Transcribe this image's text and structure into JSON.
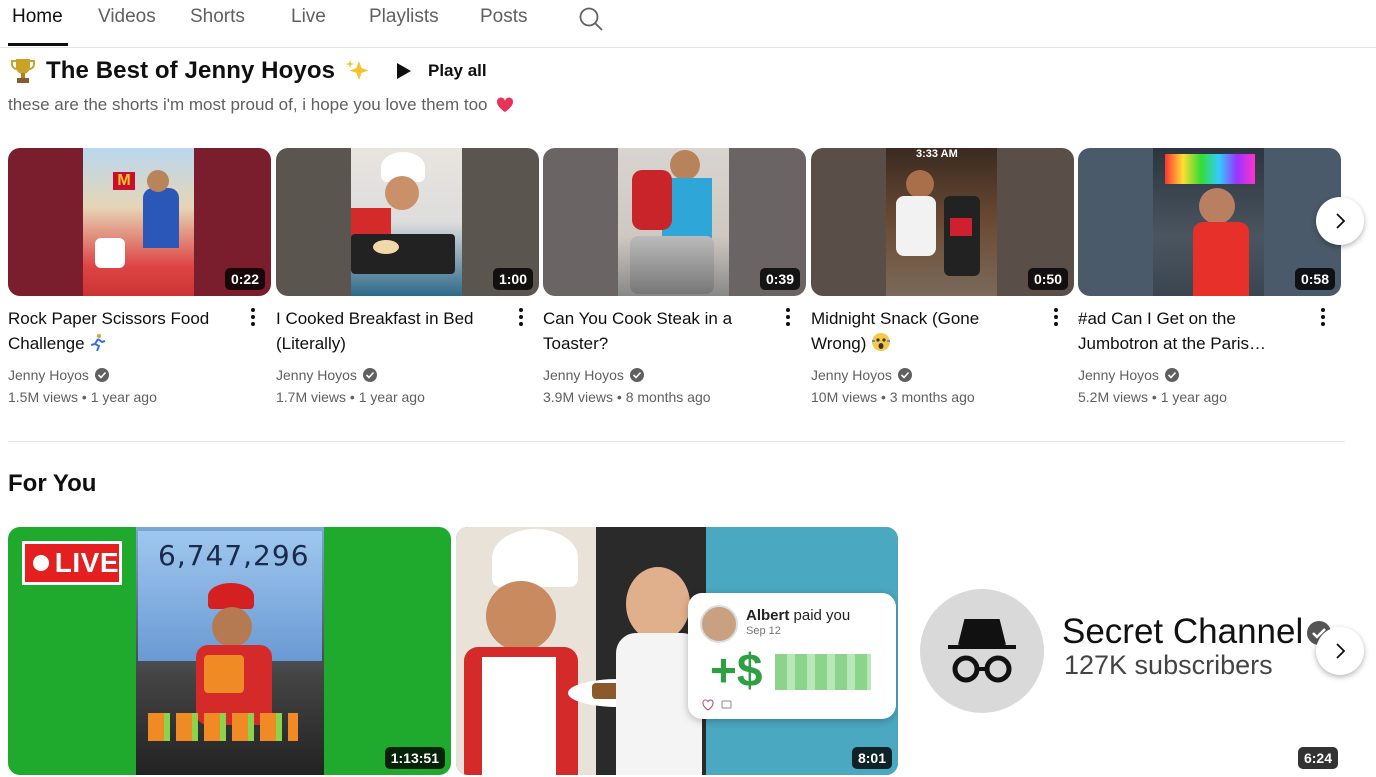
{
  "tabs": [
    {
      "label": "Home",
      "active": true
    },
    {
      "label": "Videos"
    },
    {
      "label": "Shorts"
    },
    {
      "label": "Live"
    },
    {
      "label": "Playlists"
    },
    {
      "label": "Posts"
    }
  ],
  "shelf": {
    "title": "The Best of Jenny Hoyos",
    "play_all": "Play all",
    "description": "these are the shorts i'm most proud of, i hope you love them too"
  },
  "shorts": [
    {
      "title_line1": "Rock Paper Scissors Food",
      "title_line2": "Challenge",
      "duration": "0:22",
      "channel": "Jenny Hoyos",
      "meta": "1.5M views • 1 year ago"
    },
    {
      "title_line1": "I Cooked Breakfast in Bed",
      "title_line2": "(Literally)",
      "duration": "1:00",
      "channel": "Jenny Hoyos",
      "meta": "1.7M views • 1 year ago"
    },
    {
      "title_line1": "Can You Cook Steak in a",
      "title_line2": "Toaster?",
      "duration": "0:39",
      "channel": "Jenny Hoyos",
      "meta": "3.9M views • 8 months ago"
    },
    {
      "title_line1": "Midnight Snack (Gone",
      "title_line2": "Wrong)",
      "duration": "0:50",
      "channel": "Jenny Hoyos",
      "meta": "10M views • 3 months ago",
      "overlay": "3:33 AM"
    },
    {
      "title_line1": "#ad Can I Get on the",
      "title_line2": "Jumbotron at the Paris…",
      "duration": "0:58",
      "channel": "Jenny Hoyos",
      "meta": "5.2M views • 1 year ago"
    }
  ],
  "for_you": {
    "title": "For You",
    "videos": [
      {
        "duration": "1:13:51",
        "live_label": "LIVE",
        "counter": "6,747,296"
      },
      {
        "duration": "8:01",
        "pay_name": "Albert",
        "pay_action": "paid you",
        "pay_date": "Sep 12",
        "pay_amount": "+$"
      },
      {
        "duration": "6:24",
        "channel_name": "Secret Channel",
        "subscribers": "127K subscribers"
      }
    ]
  },
  "colors": {
    "accent": "#0f0f0f",
    "secondary_text": "#606060",
    "live_red": "#e31f1f",
    "money_green": "#2ea043"
  }
}
